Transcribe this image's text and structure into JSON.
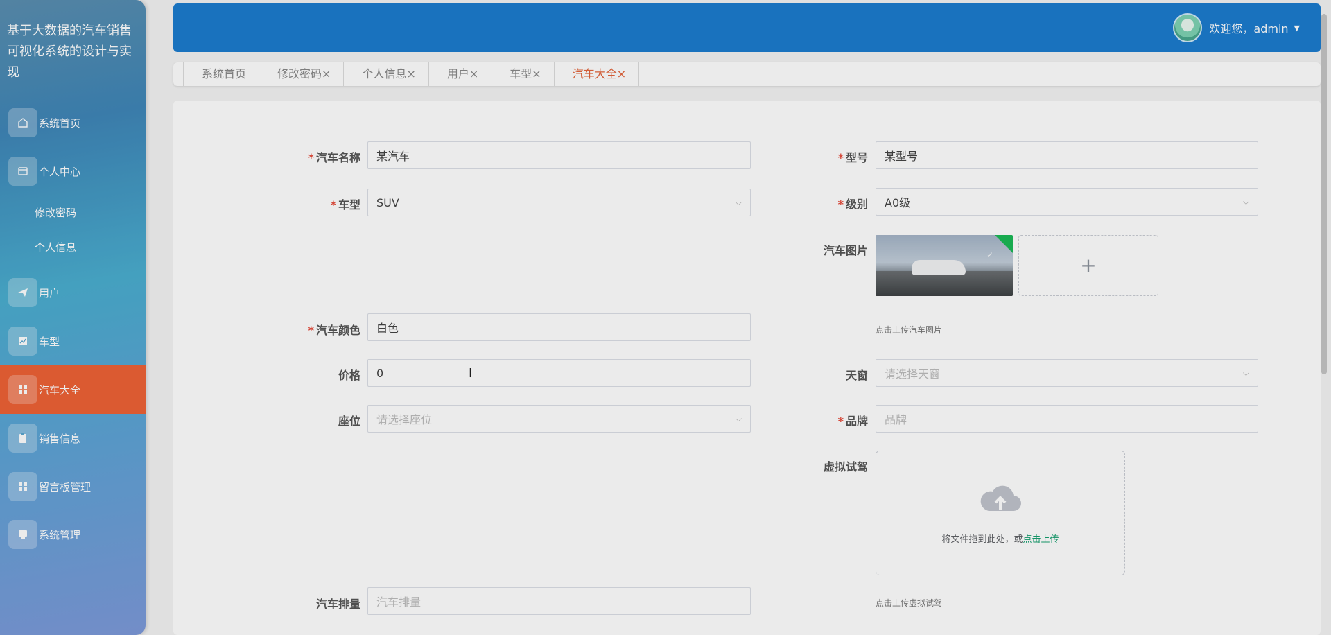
{
  "sidebar": {
    "brand": "基于大数据的汽车销售可视化系统的设计与实现",
    "menu": [
      {
        "label": "系统首页",
        "icon": "home-icon"
      },
      {
        "label": "个人中心",
        "icon": "card-icon"
      },
      {
        "label": "用户",
        "icon": "send-icon"
      },
      {
        "label": "车型",
        "icon": "chart-icon"
      },
      {
        "label": "汽车大全",
        "icon": "grid-icon"
      },
      {
        "label": "销售信息",
        "icon": "clipboard-icon"
      },
      {
        "label": "留言板管理",
        "icon": "grid-icon"
      },
      {
        "label": "系统管理",
        "icon": "monitor-icon"
      }
    ],
    "submenu": [
      "修改密码",
      "个人信息"
    ]
  },
  "header": {
    "user_label": "欢迎您，admin"
  },
  "tabs": [
    "系统首页",
    "修改密码×",
    "个人信息×",
    "用户×",
    "车型×",
    "汽车大全×"
  ],
  "form": {
    "car_name": {
      "label": "汽车名称",
      "value": "某汽车"
    },
    "model_no": {
      "label": "型号",
      "value": "某型号"
    },
    "car_type": {
      "label": "车型",
      "value": "SUV"
    },
    "level": {
      "label": "级别",
      "value": "A0级"
    },
    "car_image": {
      "label": "汽车图片",
      "hint": "点击上传汽车图片"
    },
    "color": {
      "label": "汽车颜色",
      "value": "白色"
    },
    "price": {
      "label": "价格",
      "value": "0"
    },
    "sunroof": {
      "label": "天窗",
      "placeholder": "请选择天窗"
    },
    "seats": {
      "label": "座位",
      "placeholder": "请选择座位"
    },
    "brand": {
      "label": "品牌",
      "placeholder": "品牌"
    },
    "virtual_drive": {
      "label": "虚拟试驾",
      "drop_text": "将文件拖到此处，或",
      "drop_link": "点击上传",
      "hint": "点击上传虚拟试驾"
    },
    "displacement": {
      "label": "汽车排量",
      "placeholder": "汽车排量"
    }
  },
  "colors": {
    "header": "#1c7ccf",
    "active_menu": "#ee6236",
    "active_tab": "#e3643b",
    "required": "#e74c3c",
    "link": "#16a06f"
  }
}
